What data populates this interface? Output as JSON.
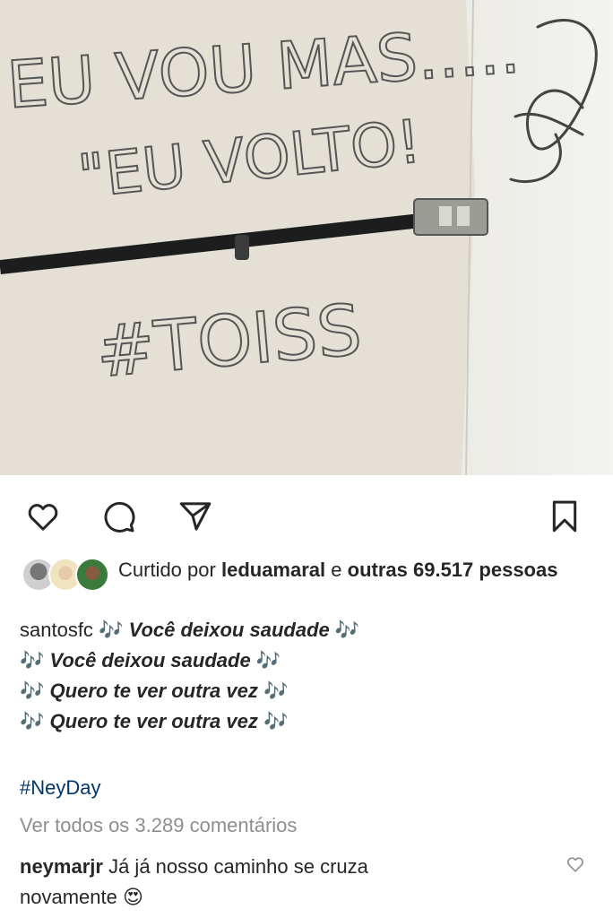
{
  "post": {
    "image_alt": "Wall with handwritten text",
    "photo_text": {
      "line1": "EU VOU MAS.....",
      "line2": "\"EU VOLTO!",
      "line3": "#TOISS"
    }
  },
  "actions": {
    "like_icon": "heart-icon",
    "comment_icon": "comment-icon",
    "share_icon": "send-icon",
    "save_icon": "bookmark-icon"
  },
  "likes": {
    "prefix": "Curtido por",
    "user": "leduamaral",
    "conj": "e",
    "others": "outras 69.517",
    "suffix": "pessoas"
  },
  "caption": {
    "username": "santosfc",
    "note": "🎶",
    "line1": "Você deixou saudade",
    "line2": "Você deixou saudade",
    "line3": "Quero te ver outra vez",
    "line4": "Quero te ver outra vez",
    "hashtag": "#NeyDay"
  },
  "comments": {
    "view_all": "Ver todos os 3.289 comentários",
    "items": [
      {
        "username": "neymarjr",
        "text": "Já já nosso caminho se cruza",
        "text2": "novamente",
        "emoji": "😍"
      }
    ]
  },
  "colors": {
    "link": "#00376b",
    "muted": "#8e8e8e",
    "note": "#8e44ad"
  }
}
